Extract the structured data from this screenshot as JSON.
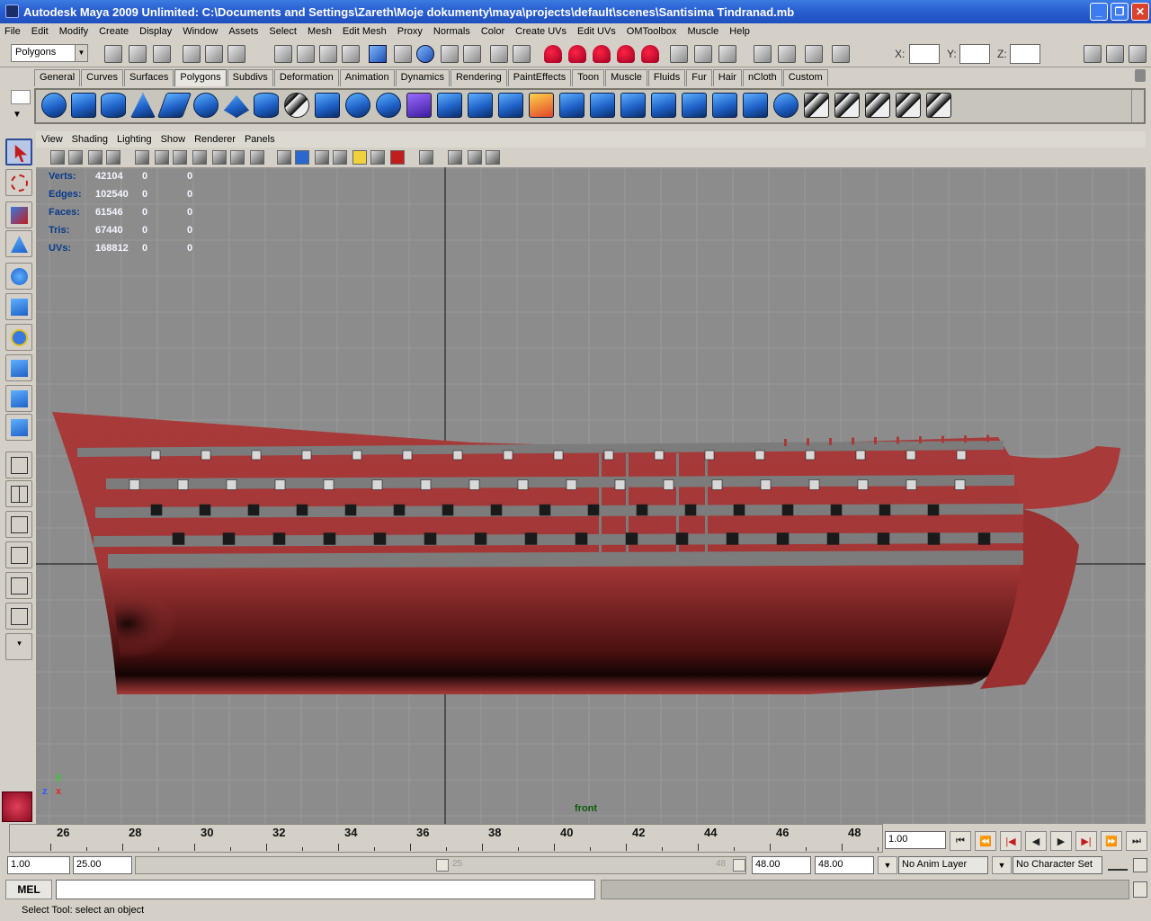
{
  "window": {
    "title": "Autodesk Maya 2009 Unlimited: C:\\Documents and Settings\\Zareth\\Moje dokumenty\\maya\\projects\\default\\scenes\\Santisima Tindranad.mb",
    "minimize": "_",
    "maximize": "❐",
    "close": "✕"
  },
  "menubar": [
    "File",
    "Edit",
    "Modify",
    "Create",
    "Display",
    "Window",
    "Assets",
    "Select",
    "Mesh",
    "Edit Mesh",
    "Proxy",
    "Normals",
    "Color",
    "Create UVs",
    "Edit UVs",
    "OMToolbox",
    "Muscle",
    "Help"
  ],
  "status": {
    "menuset": "Polygons",
    "x_label": "X:",
    "y_label": "Y:",
    "z_label": "Z:"
  },
  "shelf_tabs": [
    "General",
    "Curves",
    "Surfaces",
    "Polygons",
    "Subdivs",
    "Deformation",
    "Animation",
    "Dynamics",
    "Rendering",
    "PaintEffects",
    "Toon",
    "Muscle",
    "Fluids",
    "Fur",
    "Hair",
    "nCloth",
    "Custom"
  ],
  "shelf_active": "Polygons",
  "panel_menu": [
    "View",
    "Shading",
    "Lighting",
    "Show",
    "Renderer",
    "Panels"
  ],
  "hud": [
    {
      "label": "Verts:",
      "v1": "42104",
      "v2": "0",
      "v3": "0"
    },
    {
      "label": "Edges:",
      "v1": "102540",
      "v2": "0",
      "v3": "0"
    },
    {
      "label": "Faces:",
      "v1": "61546",
      "v2": "0",
      "v3": "0"
    },
    {
      "label": "Tris:",
      "v1": "67440",
      "v2": "0",
      "v3": "0"
    },
    {
      "label": "UVs:",
      "v1": "168812",
      "v2": "0",
      "v3": "0"
    }
  ],
  "viewport": {
    "camera": "front",
    "axis_y": "y",
    "axis_z": "z",
    "axis_x": "x",
    "hull_color": "#a83a3a",
    "stripe_color": "#7c7c7c",
    "grid_color": "#9a9a9a",
    "bg_color": "#8c8c8c"
  },
  "timeline": {
    "labels": [
      "26",
      "28",
      "30",
      "32",
      "34",
      "36",
      "38",
      "40",
      "42",
      "44",
      "46",
      "48"
    ],
    "current_frame": "1.00"
  },
  "playback": {
    "go_start": "⏮",
    "step_back_key": "⏪",
    "step_back": "|◀",
    "play_back": "◀",
    "play_fwd": "▶",
    "step_fwd": "▶|",
    "step_fwd_key": "⏩",
    "go_end": "⏭"
  },
  "range": {
    "start": "1.00",
    "playback_start": "25.00",
    "slider_start": "25",
    "slider_end": "48",
    "playback_end": "48.00",
    "end": "48.00",
    "anim_layer": "No Anim Layer",
    "char_set": "No Character Set"
  },
  "mel": {
    "label": "MEL"
  },
  "help_line": "Select Tool: select an object"
}
